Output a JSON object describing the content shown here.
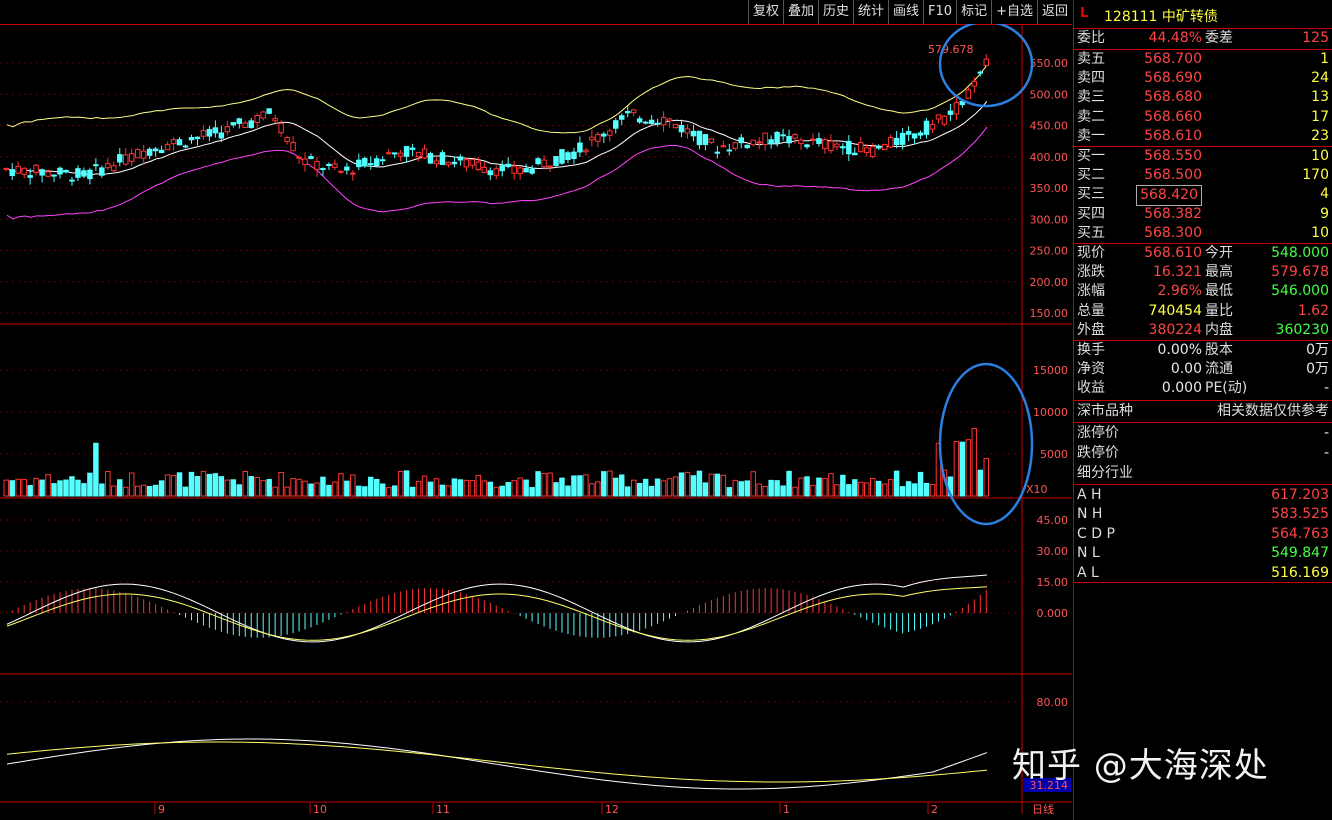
{
  "toolbar": {
    "buttons": [
      "复权",
      "叠加",
      "历史",
      "统计",
      "画线",
      "F10",
      "标记",
      "+自选",
      "返回"
    ]
  },
  "header": {
    "marker": "L",
    "code_name": "128111 中矿转债"
  },
  "orderbook": {
    "weibi_label": "委比",
    "weibi": "44.48%",
    "weicha_label": "委差",
    "weicha": "125",
    "asks": [
      {
        "label": "卖五",
        "price": "568.700",
        "vol": "1"
      },
      {
        "label": "卖四",
        "price": "568.690",
        "vol": "24"
      },
      {
        "label": "卖三",
        "price": "568.680",
        "vol": "13"
      },
      {
        "label": "卖二",
        "price": "568.660",
        "vol": "17"
      },
      {
        "label": "卖一",
        "price": "568.610",
        "vol": "23"
      }
    ],
    "bids": [
      {
        "label": "买一",
        "price": "568.550",
        "vol": "10"
      },
      {
        "label": "买二",
        "price": "568.500",
        "vol": "170"
      },
      {
        "label": "买三",
        "price": "568.420",
        "vol": "4"
      },
      {
        "label": "买四",
        "price": "568.382",
        "vol": "9"
      },
      {
        "label": "买五",
        "price": "568.300",
        "vol": "10"
      }
    ]
  },
  "quote": [
    {
      "l1": "现价",
      "v1": "568.610",
      "c1": "red",
      "l2": "今开",
      "v2": "548.000",
      "c2": "green"
    },
    {
      "l1": "涨跌",
      "v1": "16.321",
      "c1": "red",
      "l2": "最高",
      "v2": "579.678",
      "c2": "red"
    },
    {
      "l1": "涨幅",
      "v1": "2.96%",
      "c1": "red",
      "l2": "最低",
      "v2": "546.000",
      "c2": "green"
    },
    {
      "l1": "总量",
      "v1": "740454",
      "c1": "yellow",
      "l2": "量比",
      "v2": "1.62",
      "c2": "red"
    },
    {
      "l1": "外盘",
      "v1": "380224",
      "c1": "red",
      "l2": "内盘",
      "v2": "360230",
      "c2": "green"
    }
  ],
  "fundamentals": [
    {
      "l1": "换手",
      "v1": "0.00%",
      "l2": "股本",
      "v2": "0万"
    },
    {
      "l1": "净资",
      "v1": "0.00",
      "l2": "流通",
      "v2": "0万"
    },
    {
      "l1": "收益",
      "v1": "0.000",
      "l2": "PE(动)",
      "v2": "-"
    }
  ],
  "market": {
    "label": "深市品种",
    "note": "相关数据仅供参考"
  },
  "limits": [
    {
      "label": "涨停价",
      "value": "-"
    },
    {
      "label": "跌停价",
      "value": "-"
    },
    {
      "label": "细分行业",
      "value": ""
    }
  ],
  "pivots": [
    {
      "label": "A H",
      "value": "617.203",
      "color": "red"
    },
    {
      "label": "N H",
      "value": "583.525",
      "color": "red"
    },
    {
      "label": "C D P",
      "value": "564.763",
      "color": "red"
    },
    {
      "label": "N L",
      "value": "549.847",
      "color": "green"
    },
    {
      "label": "A L",
      "value": "516.169",
      "color": "yellow"
    }
  ],
  "chart": {
    "price_axis": [
      "550.00",
      "500.00",
      "450.00",
      "400.00",
      "350.00",
      "300.00",
      "250.00",
      "200.00",
      "150.00"
    ],
    "vol_axis": [
      "15000",
      "10000",
      "5000"
    ],
    "vol_unit": "X10",
    "macd_axis": [
      "45.00",
      "30.00",
      "15.00",
      "0.000"
    ],
    "kdj_axis": [
      "80.00"
    ],
    "kdj_value": "31.214",
    "high_label": "579.678",
    "months": [
      "9",
      "10",
      "11",
      "12",
      "1",
      "2"
    ],
    "period": "日线"
  },
  "watermark": "知乎 @大海深处",
  "colors": {
    "up": "#ff3333",
    "down": "#54ffff",
    "grid": "#cc0000",
    "ma": "#ffffff",
    "upper": "#ffff88",
    "lower": "#ff44ff"
  }
}
